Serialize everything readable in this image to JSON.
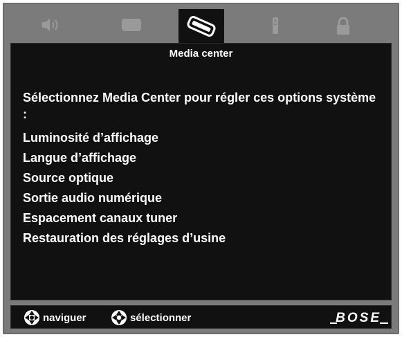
{
  "tabs": [
    {
      "name": "speaker",
      "active": false
    },
    {
      "name": "screen",
      "active": false
    },
    {
      "name": "media-center",
      "active": true
    },
    {
      "name": "remote",
      "active": false
    },
    {
      "name": "lock",
      "active": false
    }
  ],
  "panel": {
    "title": "Media center",
    "prompt": "Sélectionnez Media Center pour régler ces options système :",
    "options": [
      "Luminosité d’affichage",
      "Langue d’affichage",
      "Source optique",
      "Sortie audio numérique",
      "Espacement canaux tuner",
      "Restauration des réglages d’usine"
    ]
  },
  "footer": {
    "navigate_label": "naviguer",
    "select_label": "sélectionner",
    "brand": "BOSE"
  },
  "colors": {
    "frame": "#7b7b7b",
    "panel": "#111111",
    "text": "#ffffff",
    "inactive_icon": "#9a9a9a"
  }
}
